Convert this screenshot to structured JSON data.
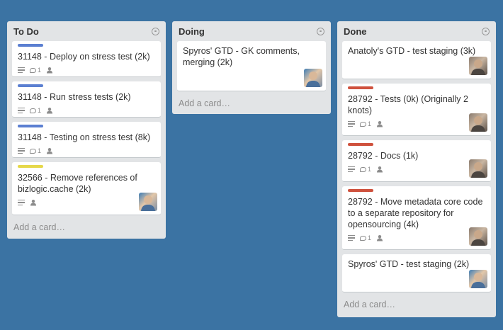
{
  "lists": [
    {
      "title": "To Do",
      "add_card": "Add a card…",
      "cards": [
        {
          "label_color": "#5b7fd1",
          "title": "31148 - Deploy on stress test (2k)",
          "comments": "1"
        },
        {
          "label_color": "#5b7fd1",
          "title": "31148 - Run stress tests (2k)",
          "comments": "1"
        },
        {
          "label_color": "#5b7fd1",
          "title": "31148 - Testing on stress test (8k)",
          "comments": "1"
        },
        {
          "label_color": "#e6d84a",
          "title": "32566 - Remove references of bizlogic.cache (2k)"
        }
      ]
    },
    {
      "title": "Doing",
      "add_card": "Add a card…",
      "cards": [
        {
          "title": "Spyros' GTD - GK comments, merging (2k)"
        }
      ]
    },
    {
      "title": "Done",
      "add_card": "Add a card…",
      "cards": [
        {
          "title": "Anatoly's GTD - test staging (3k)"
        },
        {
          "label_color": "#cf513d",
          "title": "28792 - Tests (0k) (Originally 2 knots)",
          "comments": "1"
        },
        {
          "label_color": "#cf513d",
          "title": "28792 - Docs (1k)",
          "comments": "1"
        },
        {
          "label_color": "#cf513d",
          "title": "28792 - Move metadata core code to a separate repository for opensourcing (4k)",
          "comments": "1"
        },
        {
          "title": "Spyros' GTD - test staging (2k)"
        }
      ]
    }
  ],
  "icons": {
    "list_menu": "circle-menu-icon",
    "description": "description-icon",
    "comment": "comment-icon",
    "member": "member-icon"
  },
  "colors": {
    "board_background": "#3b73a3",
    "list_background": "#e2e4e6",
    "blue_label": "#5b7fd1",
    "yellow_label": "#e6d84a",
    "red_label": "#cf513d"
  }
}
